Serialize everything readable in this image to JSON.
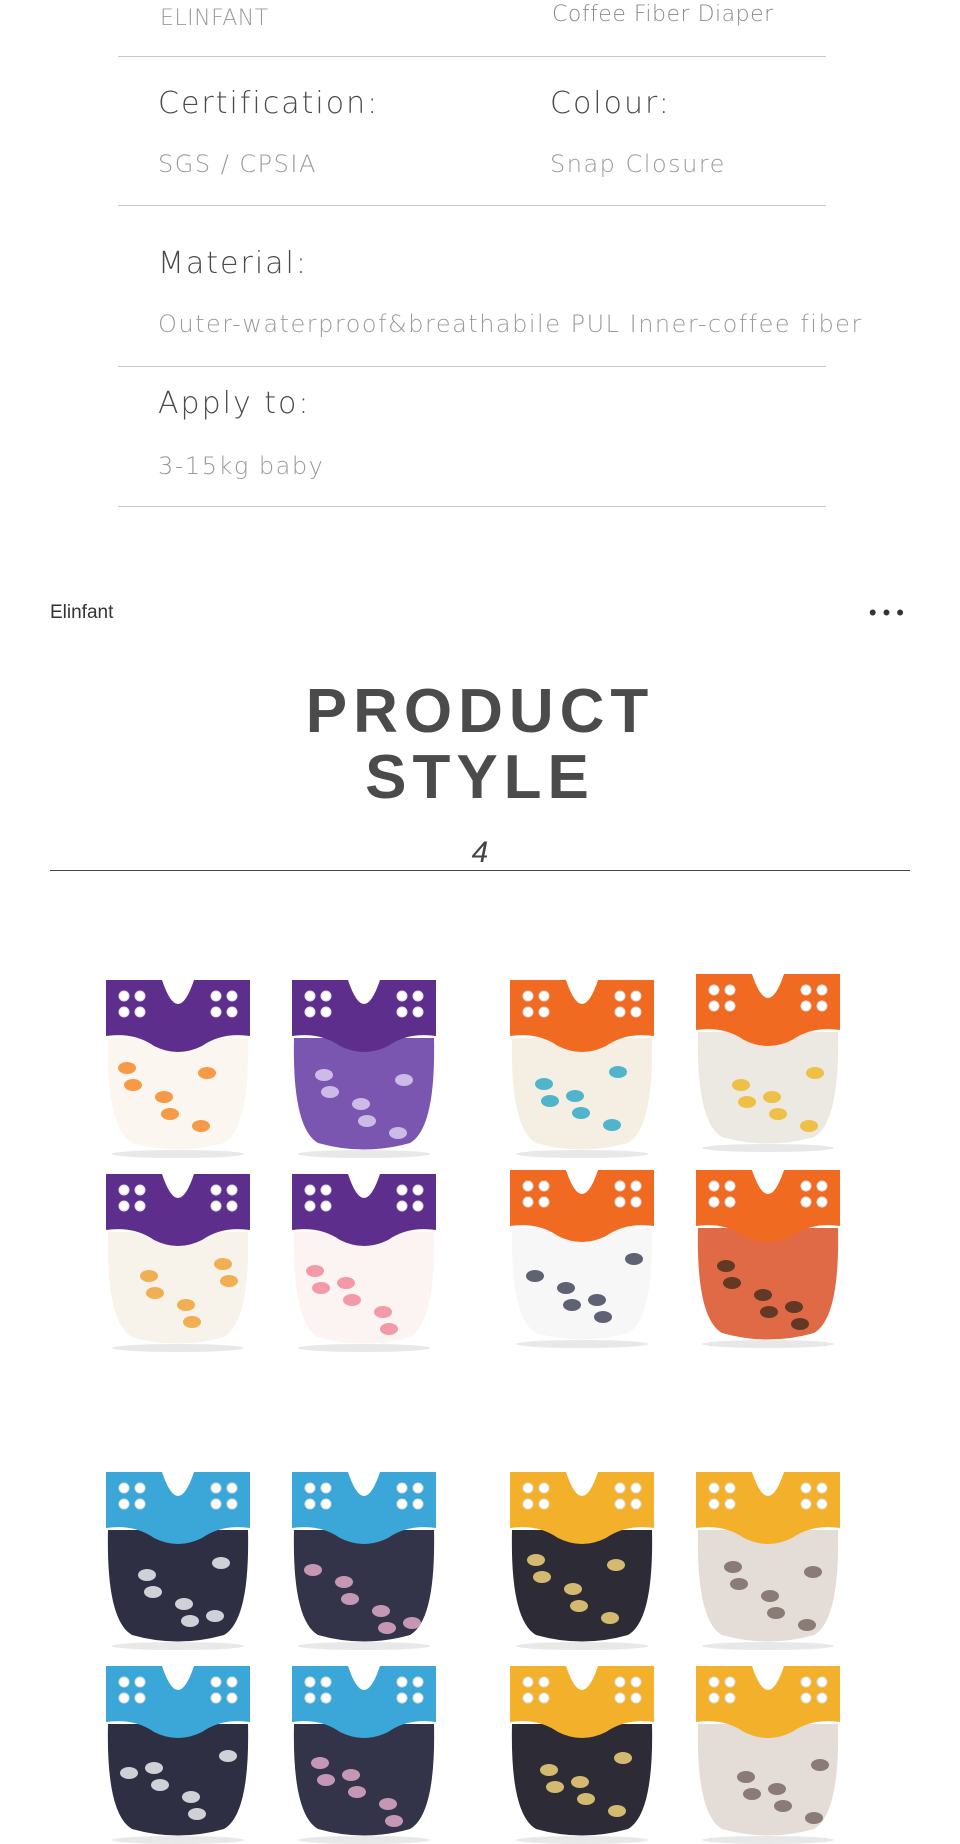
{
  "specs": {
    "brand_value": "ELINFANT",
    "product_value": "Coffee Fiber Diaper",
    "certification_label": "Certification:",
    "certification_value": "SGS / CPSIA",
    "colour_label": "Colour:",
    "colour_value": "Snap Closure",
    "material_label": "Material:",
    "material_value": "Outer-waterproof&breathabile PUL Inner-coffee fiber",
    "apply_label": "Apply to:",
    "apply_value": "3-15kg baby"
  },
  "header": {
    "brand": "Elinfant",
    "menu_icon": "more-dots-icon"
  },
  "section": {
    "title_line1": "PRODUCT",
    "title_line2": "STYLE",
    "number": "4"
  },
  "colors": {
    "purple": "#5e2e8c",
    "orange": "#f06a22",
    "blue": "#3aa7d8",
    "yellow": "#f3b02a"
  }
}
